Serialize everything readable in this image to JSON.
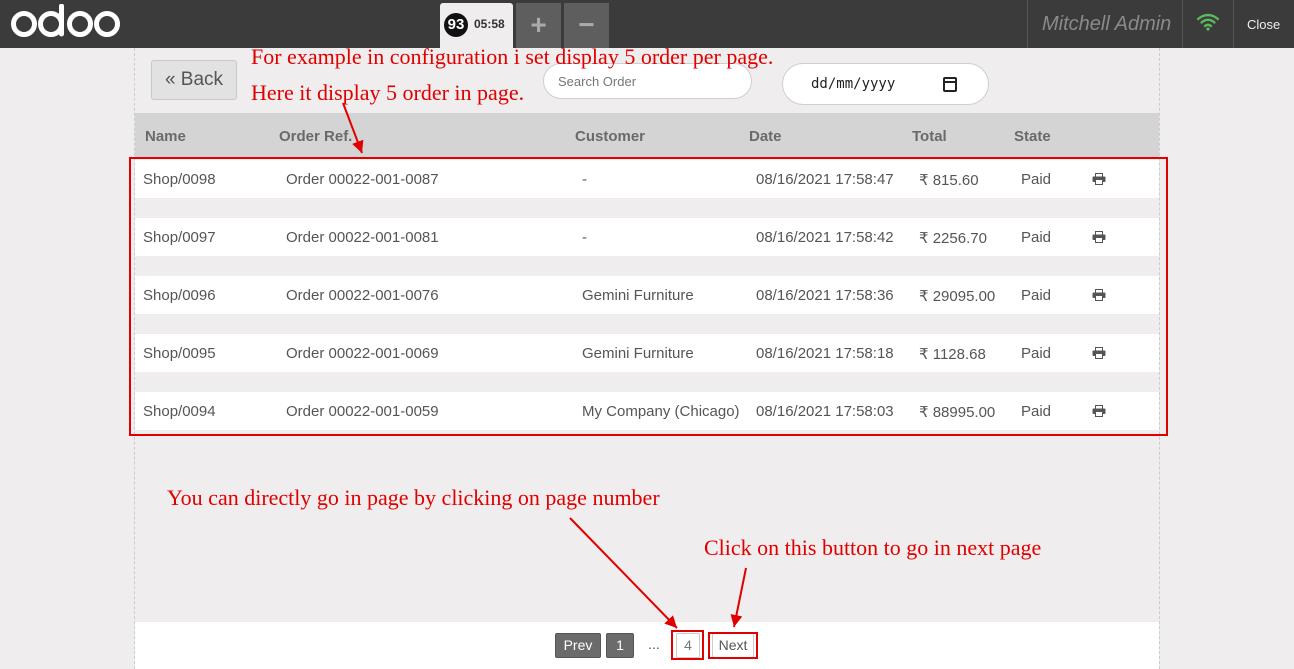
{
  "topbar": {
    "logo": "odoo",
    "order_tab": {
      "number": "93",
      "time": "05:58"
    },
    "add_label": "+",
    "remove_label": "−",
    "user_name": "Mitchell Admin",
    "close_label": "Close",
    "wifi_color": "#5cb85c"
  },
  "toolbar": {
    "back_label": "« Back",
    "search_placeholder": "Search Order",
    "date_value": "dd/mm/yyyy"
  },
  "table": {
    "headers": [
      "Name",
      "Order Ref.",
      "Customer",
      "Date",
      "Total",
      "State"
    ],
    "rows": [
      {
        "name": "Shop/0098",
        "ref": "Order 00022-001-0087",
        "customer": "-",
        "date": "08/16/2021 17:58:47",
        "total": "₹ 815.60",
        "state": "Paid"
      },
      {
        "name": "Shop/0097",
        "ref": "Order 00022-001-0081",
        "customer": "-",
        "date": "08/16/2021 17:58:42",
        "total": "₹ 2256.70",
        "state": "Paid"
      },
      {
        "name": "Shop/0096",
        "ref": "Order 00022-001-0076",
        "customer": "Gemini Furniture",
        "date": "08/16/2021 17:58:36",
        "total": "₹ 29095.00",
        "state": "Paid"
      },
      {
        "name": "Shop/0095",
        "ref": "Order 00022-001-0069",
        "customer": "Gemini Furniture",
        "date": "08/16/2021 17:58:18",
        "total": "₹ 1128.68",
        "state": "Paid"
      },
      {
        "name": "Shop/0094",
        "ref": "Order 00022-001-0059",
        "customer": "My Company (Chicago)",
        "date": "08/16/2021 17:58:03",
        "total": "₹ 88995.00",
        "state": "Paid"
      }
    ]
  },
  "pagination": {
    "prev_label": "Prev",
    "page_1": "1",
    "ellipsis": "...",
    "current_page": "4",
    "next_label": "Next"
  },
  "annotations": {
    "config_note_1": "For example in configuration  i set display 5 order per page.",
    "config_note_2": "Here it display 5 order in page.",
    "page_number_note": "You can directly go in page by clicking on page number",
    "next_button_note": "Click on this button to go in next page",
    "color": "#e00000"
  }
}
